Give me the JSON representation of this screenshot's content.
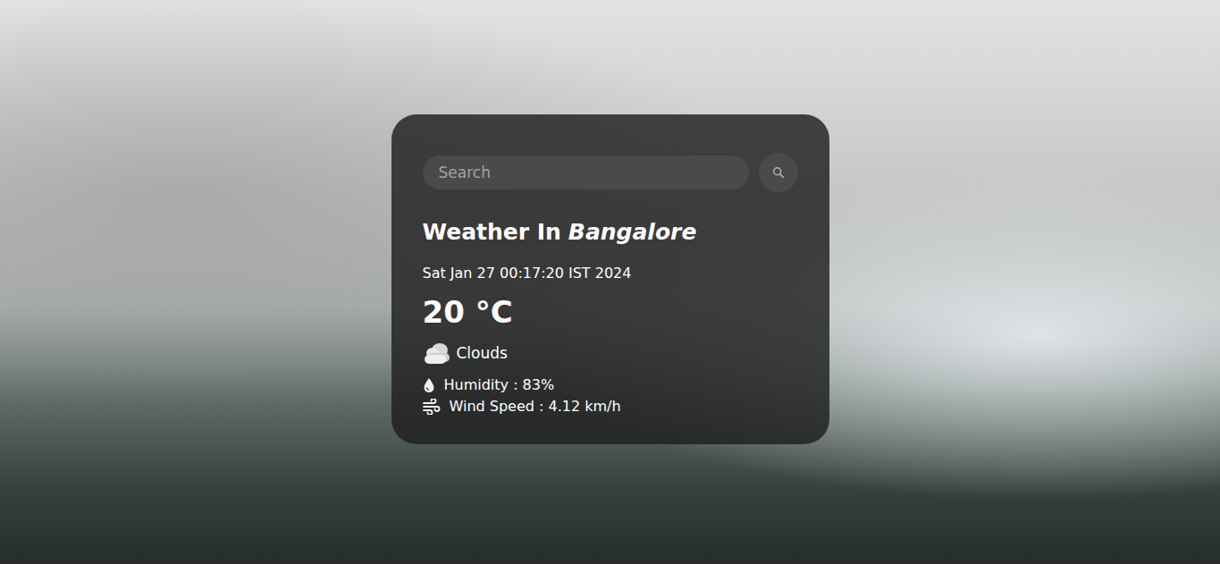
{
  "search": {
    "placeholder": "Search"
  },
  "weather": {
    "title": "Weather In",
    "city": "Bangalore",
    "datetime": "Sat Jan 27 00:17:20 IST 2024",
    "temperature": "20 °C",
    "description": "Clouds",
    "humidity": "Humidity : 83%",
    "wind": "Wind Speed : 4.12 km/h"
  }
}
